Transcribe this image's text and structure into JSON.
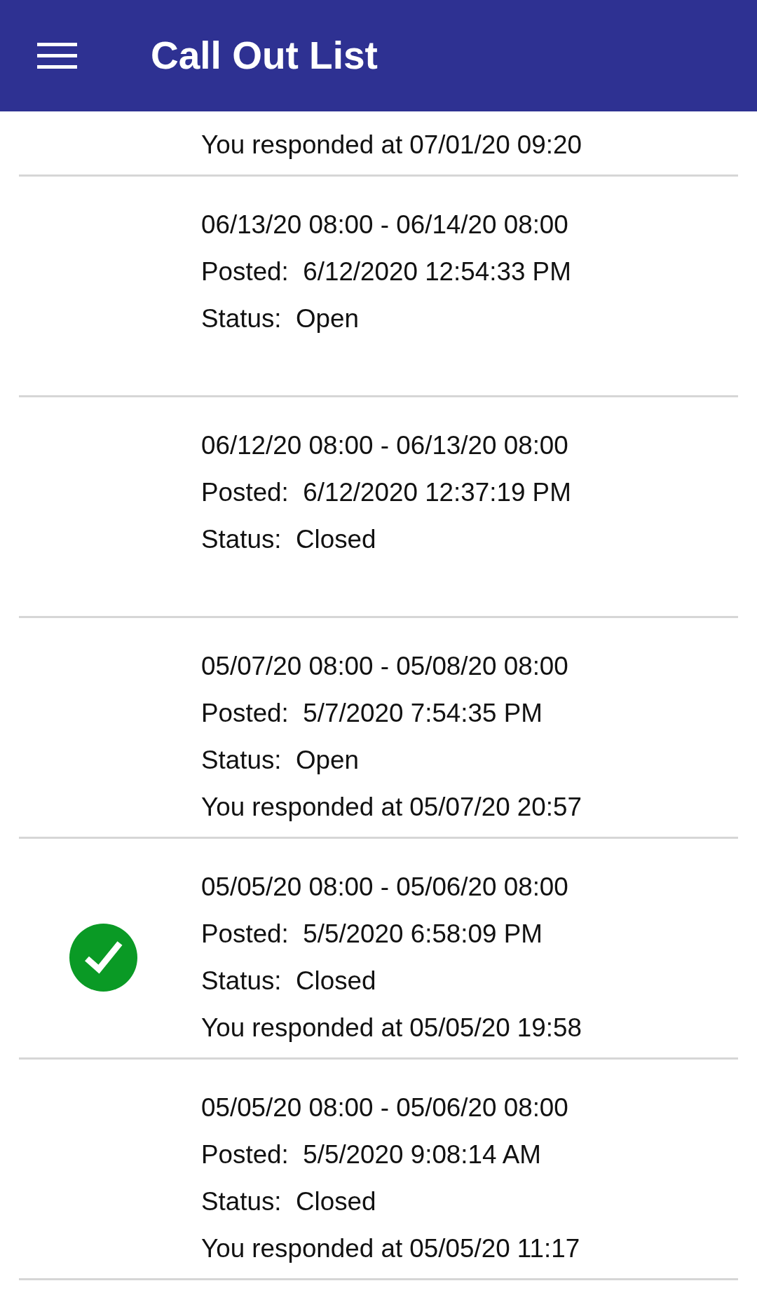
{
  "app_bar": {
    "title": "Call Out List"
  },
  "call_outs": [
    {
      "response": "You responded at 07/01/20 09:20",
      "checked": false
    },
    {
      "period": "06/13/20 08:00 - 06/14/20 08:00",
      "posted": "Posted:  6/12/2020 12:54:33 PM",
      "status": "Status:  Open",
      "checked": false
    },
    {
      "period": "06/12/20 08:00 - 06/13/20 08:00",
      "posted": "Posted:  6/12/2020 12:37:19 PM",
      "status": "Status:  Closed",
      "checked": false
    },
    {
      "period": "05/07/20 08:00 - 05/08/20 08:00",
      "posted": "Posted:  5/7/2020 7:54:35 PM",
      "status": "Status:  Open",
      "response": "You responded at 05/07/20 20:57",
      "checked": false
    },
    {
      "period": "05/05/20 08:00 - 05/06/20 08:00",
      "posted": "Posted:  5/5/2020 6:58:09 PM",
      "status": "Status:  Closed",
      "response": "You responded at 05/05/20 19:58",
      "checked": true
    },
    {
      "period": "05/05/20 08:00 - 05/06/20 08:00",
      "posted": "Posted:  5/5/2020 9:08:14 AM",
      "status": "Status:  Closed",
      "response": "You responded at 05/05/20 11:17",
      "checked": false
    }
  ]
}
